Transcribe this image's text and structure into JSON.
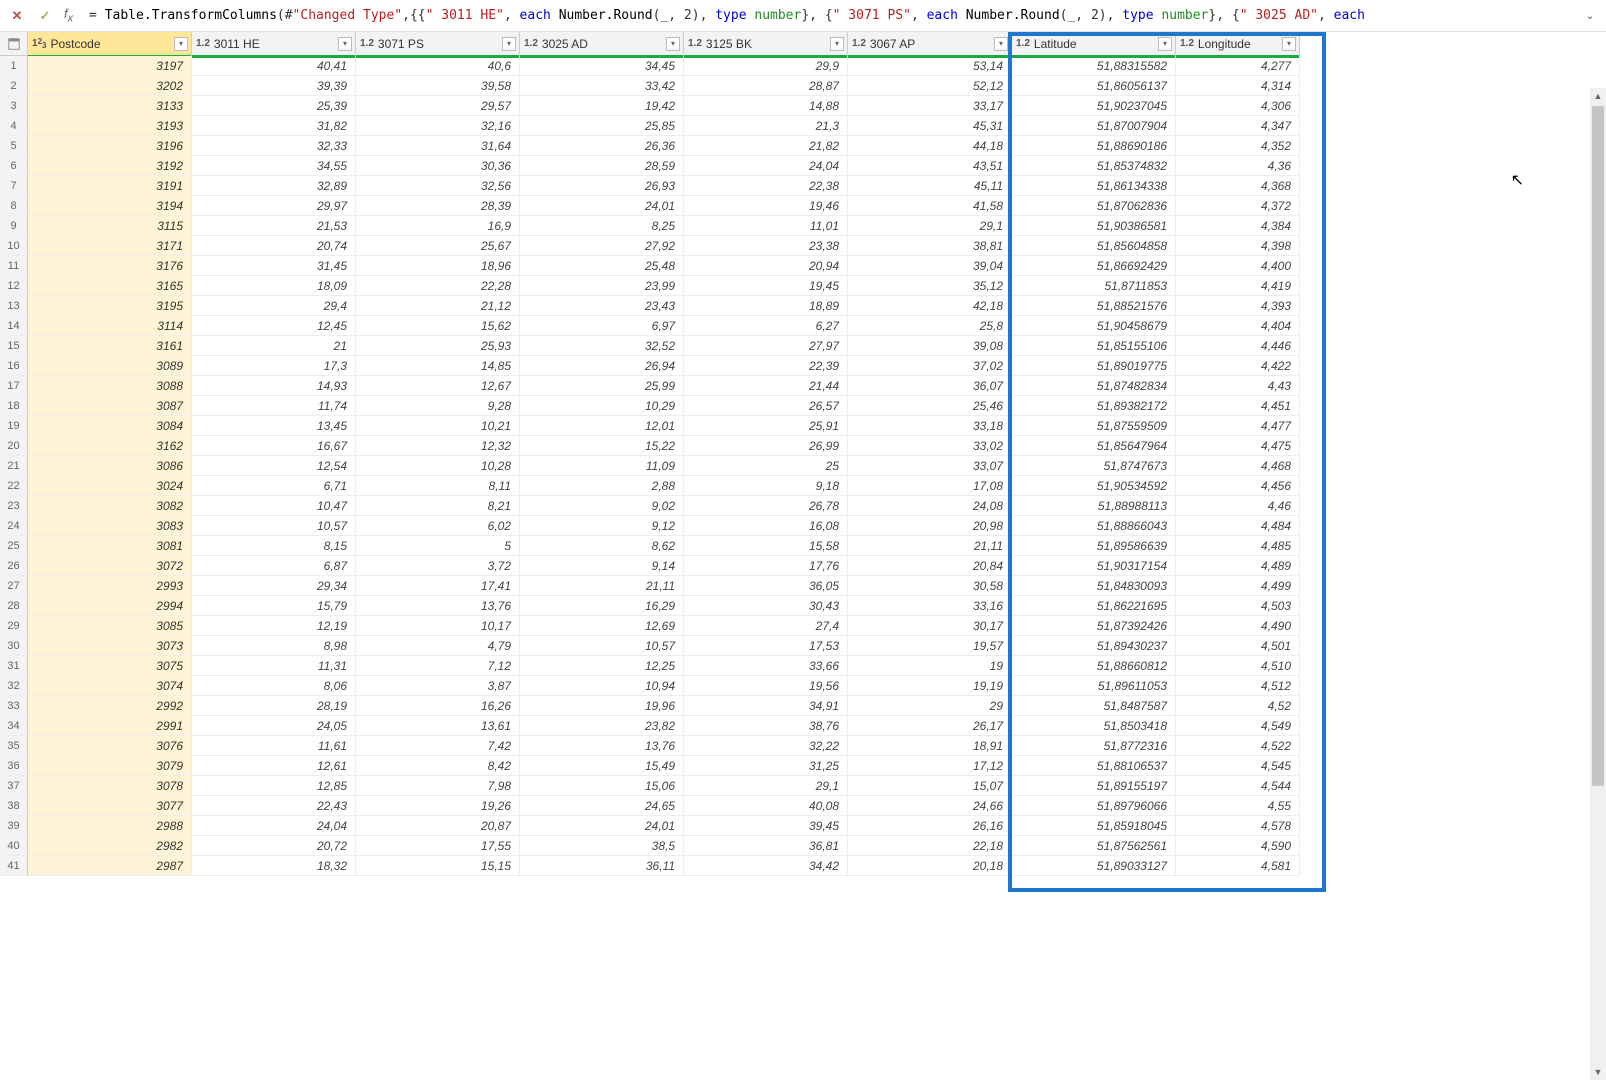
{
  "formula": {
    "prefix": "= ",
    "f1": "Table.TransformColumns",
    "open": "(#",
    "lit1": "\"Changed Type\"",
    "mid1": ",{{",
    "lit2": "\" 3011 HE\"",
    "mid2": ", ",
    "kw1": "each",
    "sp1": " ",
    "f2": "Number.Round",
    "args1": "(_, 2), ",
    "kw2": "type",
    "sp2": " ",
    "ty1": "number",
    "mid3": "}, {",
    "lit3": "\" 3071 PS\"",
    "mid4": ", ",
    "kw3": "each",
    "sp3": " ",
    "f3": "Number.Round",
    "args2": "(_, 2), ",
    "kw4": "type",
    "sp4": " ",
    "ty2": "number",
    "mid5": "}, {",
    "lit4": "\" 3025 AD\"",
    "mid6": ", ",
    "kw5": "each"
  },
  "columns": [
    {
      "type": "123",
      "name": "Postcode",
      "w": "c-pc",
      "sel": true
    },
    {
      "type": "1.2",
      "name": "3011 HE",
      "w": "c-h"
    },
    {
      "type": "1.2",
      "name": "3071 PS",
      "w": "c-h"
    },
    {
      "type": "1.2",
      "name": "3025 AD",
      "w": "c-h"
    },
    {
      "type": "1.2",
      "name": "3125 BK",
      "w": "c-h"
    },
    {
      "type": "1.2",
      "name": "3067 AP",
      "w": "c-h"
    },
    {
      "type": "1.2",
      "name": "Latitude",
      "w": "c-lat"
    },
    {
      "type": "1.2",
      "name": "Longitude",
      "w": "c-lon"
    }
  ],
  "rows": [
    [
      "3197",
      "40,41",
      "40,6",
      "34,45",
      "29,9",
      "53,14",
      "51,88315582",
      "4,277"
    ],
    [
      "3202",
      "39,39",
      "39,58",
      "33,42",
      "28,87",
      "52,12",
      "51,86056137",
      "4,314"
    ],
    [
      "3133",
      "25,39",
      "29,57",
      "19,42",
      "14,88",
      "33,17",
      "51,90237045",
      "4,306"
    ],
    [
      "3193",
      "31,82",
      "32,16",
      "25,85",
      "21,3",
      "45,31",
      "51,87007904",
      "4,347"
    ],
    [
      "3196",
      "32,33",
      "31,64",
      "26,36",
      "21,82",
      "44,18",
      "51,88690186",
      "4,352"
    ],
    [
      "3192",
      "34,55",
      "30,36",
      "28,59",
      "24,04",
      "43,51",
      "51,85374832",
      "4,36"
    ],
    [
      "3191",
      "32,89",
      "32,56",
      "26,93",
      "22,38",
      "45,11",
      "51,86134338",
      "4,368"
    ],
    [
      "3194",
      "29,97",
      "28,39",
      "24,01",
      "19,46",
      "41,58",
      "51,87062836",
      "4,372"
    ],
    [
      "3115",
      "21,53",
      "16,9",
      "8,25",
      "11,01",
      "29,1",
      "51,90386581",
      "4,384"
    ],
    [
      "3171",
      "20,74",
      "25,67",
      "27,92",
      "23,38",
      "38,81",
      "51,85604858",
      "4,398"
    ],
    [
      "3176",
      "31,45",
      "18,96",
      "25,48",
      "20,94",
      "39,04",
      "51,86692429",
      "4,400"
    ],
    [
      "3165",
      "18,09",
      "22,28",
      "23,99",
      "19,45",
      "35,12",
      "51,8711853",
      "4,419"
    ],
    [
      "3195",
      "29,4",
      "21,12",
      "23,43",
      "18,89",
      "42,18",
      "51,88521576",
      "4,393"
    ],
    [
      "3114",
      "12,45",
      "15,62",
      "6,97",
      "6,27",
      "25,8",
      "51,90458679",
      "4,404"
    ],
    [
      "3161",
      "21",
      "25,93",
      "32,52",
      "27,97",
      "39,08",
      "51,85155106",
      "4,446"
    ],
    [
      "3089",
      "17,3",
      "14,85",
      "26,94",
      "22,39",
      "37,02",
      "51,89019775",
      "4,422"
    ],
    [
      "3088",
      "14,93",
      "12,67",
      "25,99",
      "21,44",
      "36,07",
      "51,87482834",
      "4,43"
    ],
    [
      "3087",
      "11,74",
      "9,28",
      "10,29",
      "26,57",
      "25,46",
      "51,89382172",
      "4,451"
    ],
    [
      "3084",
      "13,45",
      "10,21",
      "12,01",
      "25,91",
      "33,18",
      "51,87559509",
      "4,477"
    ],
    [
      "3162",
      "16,67",
      "12,32",
      "15,22",
      "26,99",
      "33,02",
      "51,85647964",
      "4,475"
    ],
    [
      "3086",
      "12,54",
      "10,28",
      "11,09",
      "25",
      "33,07",
      "51,8747673",
      "4,468"
    ],
    [
      "3024",
      "6,71",
      "8,11",
      "2,88",
      "9,18",
      "17,08",
      "51,90534592",
      "4,456"
    ],
    [
      "3082",
      "10,47",
      "8,21",
      "9,02",
      "26,78",
      "24,08",
      "51,88988113",
      "4,46"
    ],
    [
      "3083",
      "10,57",
      "6,02",
      "9,12",
      "16,08",
      "20,98",
      "51,88866043",
      "4,484"
    ],
    [
      "3081",
      "8,15",
      "5",
      "8,62",
      "15,58",
      "21,11",
      "51,89586639",
      "4,485"
    ],
    [
      "3072",
      "6,87",
      "3,72",
      "9,14",
      "17,76",
      "20,84",
      "51,90317154",
      "4,489"
    ],
    [
      "2993",
      "29,34",
      "17,41",
      "21,11",
      "36,05",
      "30,58",
      "51,84830093",
      "4,499"
    ],
    [
      "2994",
      "15,79",
      "13,76",
      "16,29",
      "30,43",
      "33,16",
      "51,86221695",
      "4,503"
    ],
    [
      "3085",
      "12,19",
      "10,17",
      "12,69",
      "27,4",
      "30,17",
      "51,87392426",
      "4,490"
    ],
    [
      "3073",
      "8,98",
      "4,79",
      "10,57",
      "17,53",
      "19,57",
      "51,89430237",
      "4,501"
    ],
    [
      "3075",
      "11,31",
      "7,12",
      "12,25",
      "33,66",
      "19",
      "51,88660812",
      "4,510"
    ],
    [
      "3074",
      "8,06",
      "3,87",
      "10,94",
      "19,56",
      "19,19",
      "51,89611053",
      "4,512"
    ],
    [
      "2992",
      "28,19",
      "16,26",
      "19,96",
      "34,91",
      "29",
      "51,8487587",
      "4,52"
    ],
    [
      "2991",
      "24,05",
      "13,61",
      "23,82",
      "38,76",
      "26,17",
      "51,8503418",
      "4,549"
    ],
    [
      "3076",
      "11,61",
      "7,42",
      "13,76",
      "32,22",
      "18,91",
      "51,8772316",
      "4,522"
    ],
    [
      "3079",
      "12,61",
      "8,42",
      "15,49",
      "31,25",
      "17,12",
      "51,88106537",
      "4,545"
    ],
    [
      "3078",
      "12,85",
      "7,98",
      "15,06",
      "29,1",
      "15,07",
      "51,89155197",
      "4,544"
    ],
    [
      "3077",
      "22,43",
      "19,26",
      "24,65",
      "40,08",
      "24,66",
      "51,89796066",
      "4,55"
    ],
    [
      "2988",
      "24,04",
      "20,87",
      "24,01",
      "39,45",
      "26,16",
      "51,85918045",
      "4,578"
    ],
    [
      "2982",
      "20,72",
      "17,55",
      "38,5",
      "36,81",
      "22,18",
      "51,87562561",
      "4,590"
    ],
    [
      "2987",
      "18,32",
      "15,15",
      "36,11",
      "34,42",
      "20,18",
      "51,89033127",
      "4,581"
    ]
  ]
}
